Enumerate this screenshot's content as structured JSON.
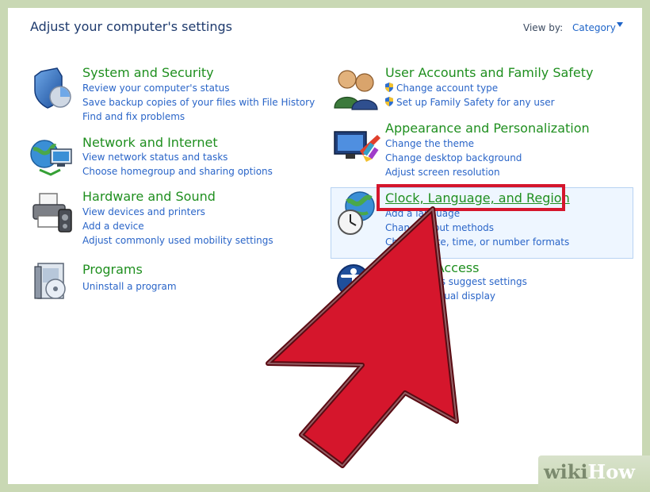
{
  "header": {
    "title": "Adjust your computer's settings",
    "view_by_label": "View by:",
    "view_by_value": "Category"
  },
  "categories": {
    "system_security": {
      "title": "System and Security",
      "links": [
        "Review your computer's status",
        "Save backup copies of your files with File History",
        "Find and fix problems"
      ]
    },
    "network_internet": {
      "title": "Network and Internet",
      "links": [
        "View network status and tasks",
        "Choose homegroup and sharing options"
      ]
    },
    "hardware_sound": {
      "title": "Hardware and Sound",
      "links": [
        "View devices and printers",
        "Add a device",
        "Adjust commonly used mobility settings"
      ]
    },
    "programs": {
      "title": "Programs",
      "links": [
        "Uninstall a program"
      ]
    },
    "user_accounts": {
      "title": "User Accounts and Family Safety",
      "links": [
        "Change account type",
        "Set up Family Safety for any user"
      ]
    },
    "appearance": {
      "title": "Appearance and Personalization",
      "links": [
        "Change the theme",
        "Change desktop background",
        "Adjust screen resolution"
      ]
    },
    "clock_language_region": {
      "title": "Clock, Language, and Region",
      "links": [
        "Add a language",
        "Change input methods",
        "Change date, time, or number formats"
      ],
      "visible_fragments": [
        "Add a lan",
        "uage",
        "Chang",
        "t methods",
        "Ch",
        ", time, or number formats"
      ]
    },
    "ease_of_access": {
      "title": "Ease of Access",
      "visible_fragments": {
        "title": "ccess",
        "link1": "suggest settings",
        "link2": "ual display"
      }
    }
  },
  "watermark": {
    "wiki": "wiki",
    "how": "How"
  },
  "colors": {
    "category_title": "#1f8f1f",
    "link": "#2a65c8",
    "header": "#1e3a6d",
    "callout_red": "#d5162c",
    "arrow_red": "#d5162c",
    "frame": "#c9d8b4",
    "highlight_bg": "#eef6ff"
  },
  "icons": [
    "shield-icon",
    "network-icon",
    "printer-icon",
    "programs-icon",
    "users-icon",
    "appearance-icon",
    "globe-clock-icon",
    "ease-of-access-icon",
    "uac-shield-icon"
  ]
}
